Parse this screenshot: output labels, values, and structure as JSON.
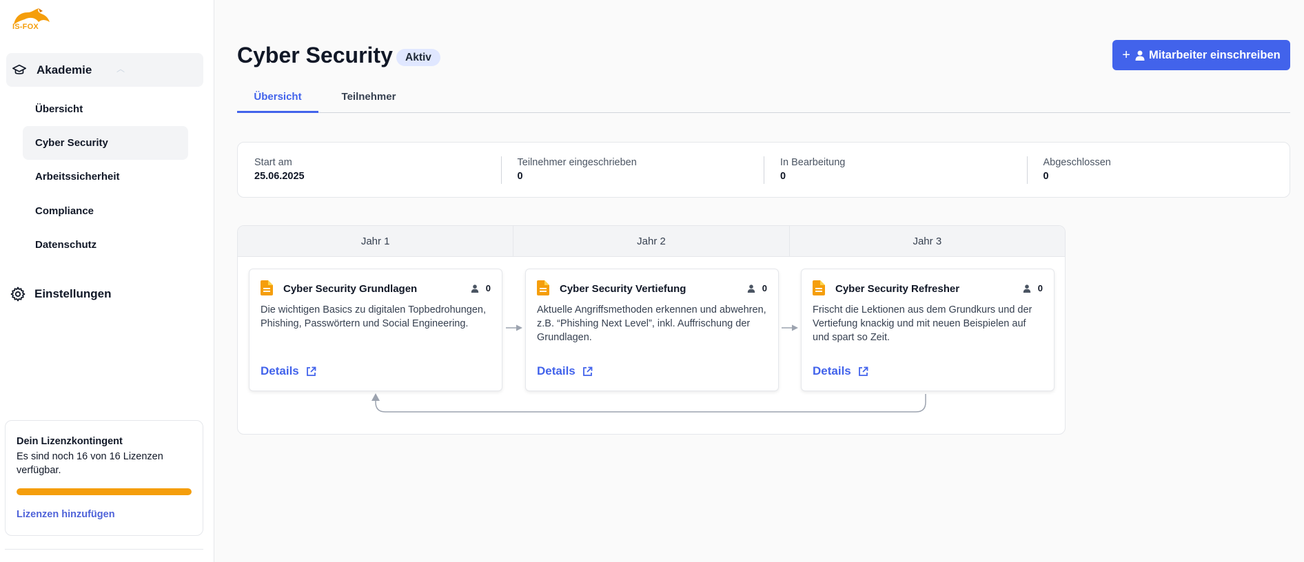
{
  "brand": {
    "logo_text": "IS-FOX",
    "accent": "#f59e0b",
    "primary": "#4263eb"
  },
  "sidebar": {
    "group": {
      "label": "Akademie",
      "icon": "graduation-cap-icon"
    },
    "items": [
      {
        "label": "Übersicht",
        "active": false
      },
      {
        "label": "Cyber Security",
        "active": true
      },
      {
        "label": "Arbeitssicherheit",
        "active": false
      },
      {
        "label": "Compliance",
        "active": false
      },
      {
        "label": "Datenschutz",
        "active": false
      }
    ],
    "settings": {
      "label": "Einstellungen",
      "icon": "gear-icon"
    },
    "license": {
      "title": "Dein Lizenzkontingent",
      "text": "Es sind noch 16 von 16 Lizenzen verfügbar.",
      "progress_percent": 100,
      "link_label": "Lizenzen hinzufügen"
    }
  },
  "header": {
    "title": "Cyber Security",
    "status": "Aktiv",
    "enroll_button": "Mitarbeiter einschreiben"
  },
  "tabs": [
    {
      "label": "Übersicht",
      "active": true
    },
    {
      "label": "Teilnehmer",
      "active": false
    }
  ],
  "stats": [
    {
      "label": "Start am",
      "value": "25.06.2025"
    },
    {
      "label": "Teilnehmer eingeschrieben",
      "value": "0"
    },
    {
      "label": "In Bearbeitung",
      "value": "0"
    },
    {
      "label": "Abgeschlossen",
      "value": "0"
    }
  ],
  "timeline": {
    "years": [
      "Jahr 1",
      "Jahr 2",
      "Jahr 3"
    ],
    "courses": [
      {
        "title": "Cyber Security Grundlagen",
        "count": "0",
        "description": "Die wichtigen Basics zu digitalen Topbedrohungen, Phishing, Passwörtern und Social Engineering.",
        "details": "Details"
      },
      {
        "title": "Cyber Security Vertiefung",
        "count": "0",
        "description": "Aktuelle Angriffsmethoden erkennen und abwehren, z.B. “Phishing Next Level”, inkl. Auffrischung der Grundlagen.",
        "details": "Details"
      },
      {
        "title": "Cyber Security Refresher",
        "count": "0",
        "description": "Frischt die Lektionen aus dem Grundkurs und der Vertiefung knackig und mit neuen Beispielen auf und spart so Zeit.",
        "details": "Details"
      }
    ]
  }
}
